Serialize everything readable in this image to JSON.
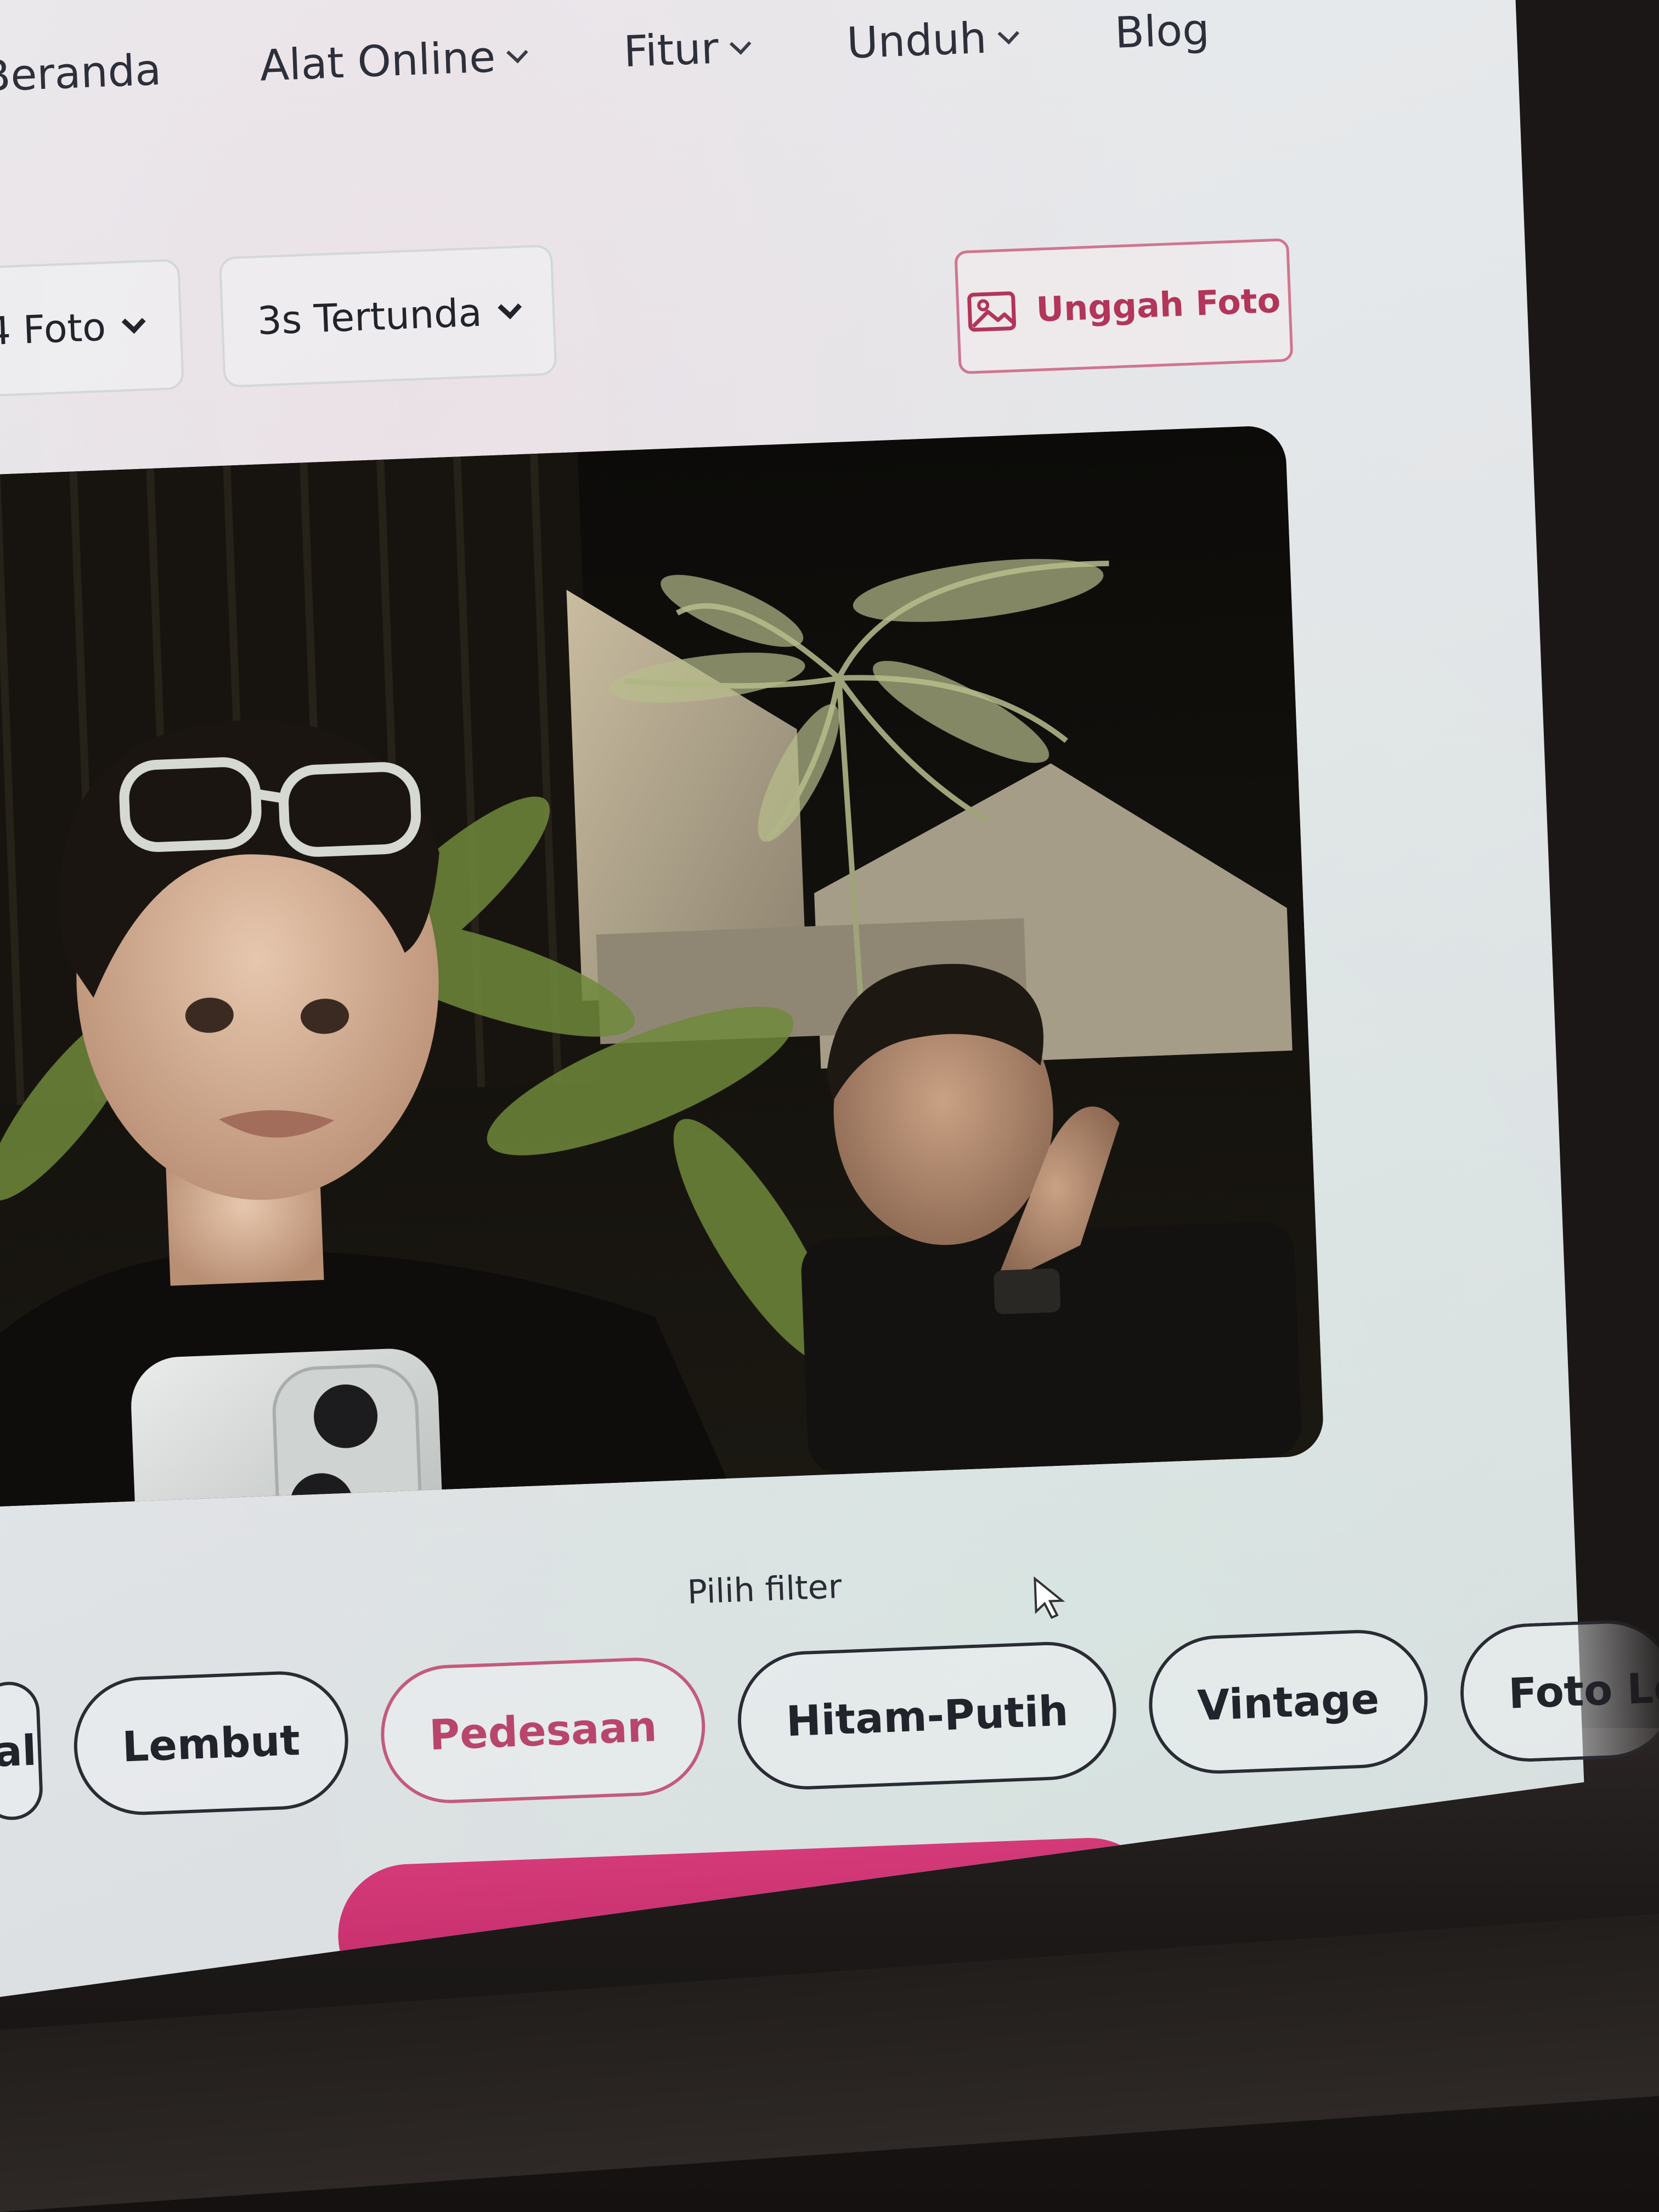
{
  "nav": {
    "items": [
      {
        "label": "Beranda",
        "has_dropdown": false
      },
      {
        "label": "Alat Online",
        "has_dropdown": true
      },
      {
        "label": "Fitur",
        "has_dropdown": true
      },
      {
        "label": "Unduh",
        "has_dropdown": true
      },
      {
        "label": "Blog",
        "has_dropdown": false
      }
    ]
  },
  "controls": {
    "photo_count": "4 Foto",
    "delay": "3s Tertunda",
    "upload_label": "Unggah Foto"
  },
  "filters": {
    "heading": "Pilih filter",
    "items": [
      {
        "label": "al",
        "selected": false
      },
      {
        "label": "Lembut",
        "selected": false
      },
      {
        "label": "Pedesaan",
        "selected": true
      },
      {
        "label": "Hitam-Putih",
        "selected": false
      },
      {
        "label": "Vintage",
        "selected": false
      },
      {
        "label": "Foto Lo",
        "selected": false
      }
    ]
  },
  "colors": {
    "accent": "#c22a69",
    "accent_text": "#b8466c",
    "upload_border": "#d07590",
    "screen_bg": "#e6e9eb"
  },
  "icons": {
    "upload": "image-icon",
    "dropdown": "chevron-down-icon"
  }
}
